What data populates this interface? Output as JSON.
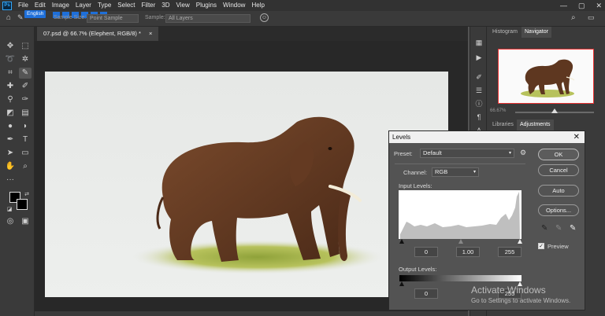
{
  "menubar": {
    "logo": "Ps",
    "items": [
      "File",
      "Edit",
      "Image",
      "Layer",
      "Type",
      "Select",
      "Filter",
      "3D",
      "View",
      "Plugins",
      "Window",
      "Help"
    ],
    "win_min": "—",
    "win_max": "▢",
    "win_close": "✕"
  },
  "options": {
    "language": "English",
    "sample_size_label": "Sample Size:",
    "sample_size_value": "Point Sample",
    "sample_label": "Sample:",
    "sample_value": "All Layers"
  },
  "document": {
    "tab_title": "07.psd @ 66.7% (Elephent, RGB/8) *",
    "tab_close": "×"
  },
  "panels": {
    "histogram_tab": "Histogram",
    "navigator_tab": "Navigator",
    "nav_zoom": "66.67%",
    "libraries_tab": "Libraries",
    "adjustments_tab": "Adjustments"
  },
  "levels": {
    "title": "Levels",
    "close": "✕",
    "preset_label": "Preset:",
    "preset_value": "Default",
    "channel_label": "Channel:",
    "channel_value": "RGB",
    "input_levels_label": "Input Levels:",
    "input_black": "0",
    "input_gamma": "1.00",
    "input_white": "255",
    "output_levels_label": "Output Levels:",
    "output_black": "0",
    "output_white": "255",
    "ok": "OK",
    "cancel": "Cancel",
    "auto": "Auto",
    "options": "Options...",
    "preview_label": "Preview",
    "preview_checked": true
  },
  "watermark": {
    "line1": "Activate Windows",
    "line2": "Go to Settings to activate Windows."
  },
  "colors": {
    "accent": "#31a8ff",
    "dialog_bg": "#535353",
    "panel_bg": "#3a3a3a"
  }
}
